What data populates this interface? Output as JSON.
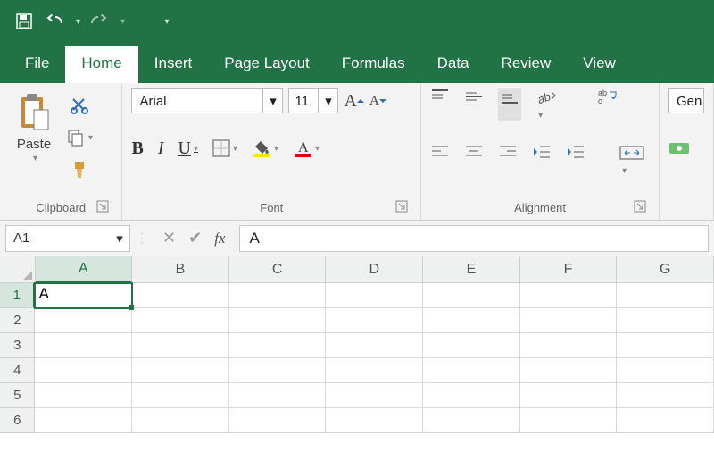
{
  "qat": {
    "save": "save-icon",
    "undo": "undo-icon",
    "redo": "redo-icon",
    "customize": "customize-icon"
  },
  "tabs": [
    "File",
    "Home",
    "Insert",
    "Page Layout",
    "Formulas",
    "Data",
    "Review",
    "View"
  ],
  "active_tab": "Home",
  "clipboard": {
    "paste_label": "Paste",
    "title": "Clipboard"
  },
  "font": {
    "title": "Font",
    "name": "Arial",
    "size": "11",
    "bold": "B",
    "italic": "I",
    "underline": "U"
  },
  "alignment": {
    "title": "Alignment"
  },
  "number": {
    "title": "",
    "general_label": "Gen"
  },
  "namebox": {
    "value": "A1"
  },
  "formula_bar": {
    "value": "A"
  },
  "columns": [
    "A",
    "B",
    "C",
    "D",
    "E",
    "F",
    "G"
  ],
  "rows": [
    1,
    2,
    3,
    4,
    5,
    6
  ],
  "cells": {
    "A1": "A"
  },
  "selected_cell": "A1",
  "colors": {
    "brand": "#217346"
  }
}
